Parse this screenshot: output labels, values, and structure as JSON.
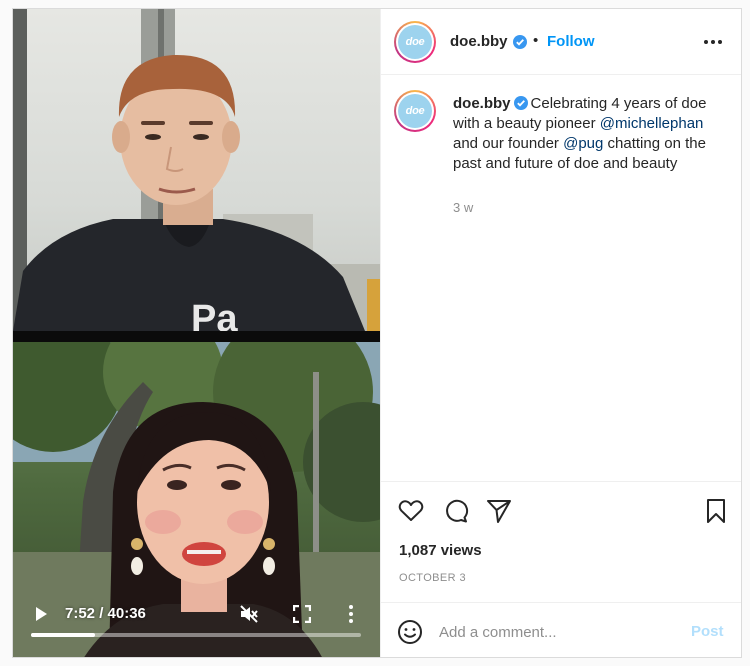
{
  "post": {
    "username": "doe.bby",
    "avatar_text": "doe",
    "follow_label": "Follow",
    "separator": "•",
    "verified_icon": "verified-badge-icon",
    "options_icon": "more-horizontal-icon"
  },
  "caption": {
    "username": "doe.bby",
    "text_1": "Celebrating 4 years of doe with a beauty pioneer ",
    "mention_1": "@michellephan",
    "text_2": " and our founder ",
    "mention_2": "@pug",
    "text_3": " chatting on the past and future of doe and beauty",
    "time": "3 w"
  },
  "video": {
    "time_display": "7:52 / 40:36",
    "progress": 0.194,
    "muted": true,
    "icons": [
      "play-icon",
      "muted-speaker-icon",
      "fullscreen-icon",
      "more-vertical-icon"
    ]
  },
  "actions": {
    "icons": [
      "heart-icon",
      "comment-icon",
      "share-icon",
      "bookmark-icon"
    ],
    "views": "1,087 views",
    "date": "OCTOBER 3"
  },
  "comment_box": {
    "placeholder": "Add a comment...",
    "value": "",
    "post_label": "Post"
  },
  "colors": {
    "accent": "#0095f6",
    "post_disabled": "#b2dffc",
    "mention": "#00376b",
    "verified": "#3897f0",
    "avatar_bg": "#9dd3ee"
  }
}
